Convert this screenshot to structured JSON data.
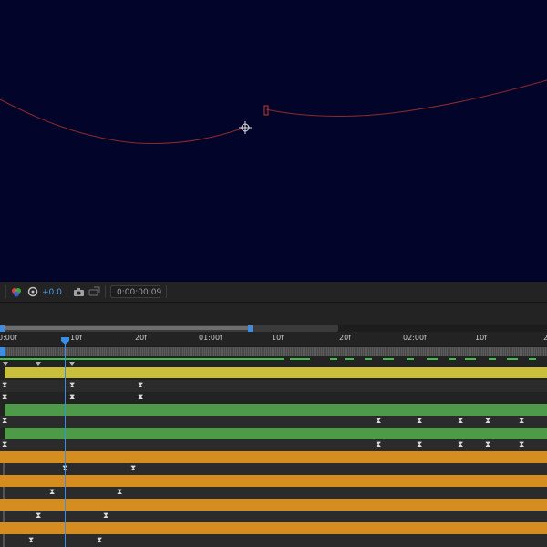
{
  "viewer": {
    "background": "#03042a",
    "path_color": "#8a2a2a"
  },
  "toolbar": {
    "exposure_value": "+0.0",
    "timecode": "0:00:00:09"
  },
  "timeline": {
    "ruler_labels": [
      "0:00f",
      "10f",
      "20f",
      "01:00f",
      "10f",
      "20f",
      "02:00f",
      "10f",
      "2"
    ],
    "current_frame": 9,
    "colors": {
      "accent": "#3b8de6",
      "yellow": "#c8c03c",
      "green": "#4e9a48",
      "orange": "#d68d20",
      "render_green": "#3fbf4a"
    },
    "keyframe_glyph": "⧗"
  }
}
